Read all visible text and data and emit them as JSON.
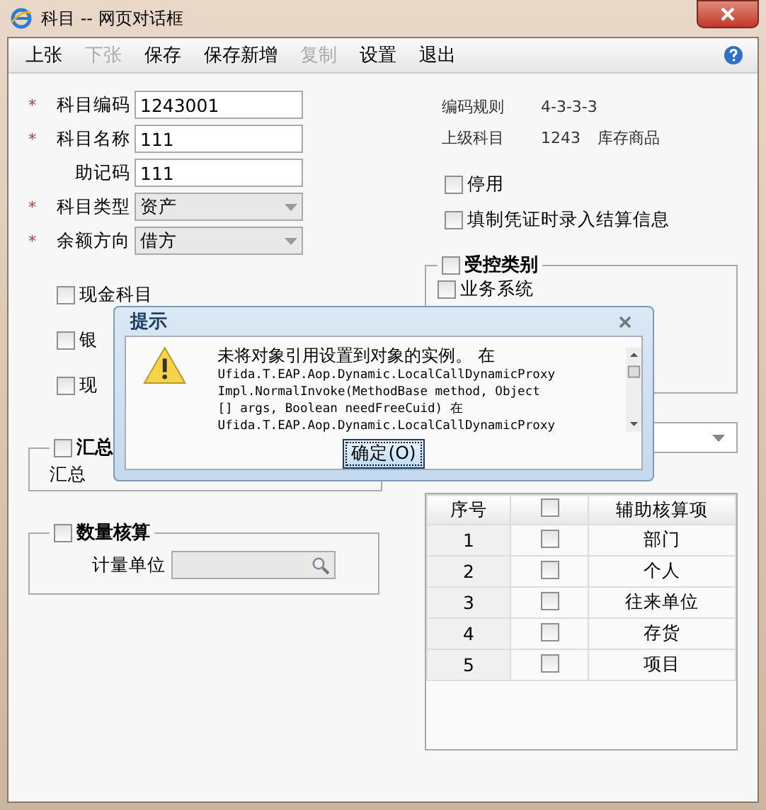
{
  "window": {
    "title": "科目 -- 网页对话框"
  },
  "toolbar": [
    {
      "label": "上张",
      "disabled": false
    },
    {
      "label": "下张",
      "disabled": true
    },
    {
      "label": "保存",
      "disabled": false
    },
    {
      "label": "保存新增",
      "disabled": false
    },
    {
      "label": "复制",
      "disabled": true
    },
    {
      "label": "设置",
      "disabled": false
    },
    {
      "label": "退出",
      "disabled": false
    }
  ],
  "required_symbol": "*",
  "fields": [
    {
      "label": "科目编码",
      "required": true,
      "kind": "text",
      "value": "1243001"
    },
    {
      "label": "科目名称",
      "required": true,
      "kind": "text",
      "value": "111"
    },
    {
      "label": "助记码",
      "required": false,
      "kind": "text",
      "value": "111"
    },
    {
      "label": "科目类型",
      "required": true,
      "kind": "select",
      "value": "资产"
    },
    {
      "label": "余额方向",
      "required": true,
      "kind": "select",
      "value": "借方"
    }
  ],
  "info": [
    {
      "label": "编码规则",
      "values": [
        "4-3-3-3"
      ]
    },
    {
      "label": "上级科目",
      "values": [
        "1243",
        "库存商品"
      ]
    }
  ],
  "options": [
    {
      "label": "停用",
      "checked": false
    },
    {
      "label": "填制凭证时录入结算信息",
      "checked": false
    }
  ],
  "cash_options": [
    {
      "label": "现金科目",
      "checked": false
    },
    {
      "label": "银",
      "checked": false
    },
    {
      "label": "现",
      "checked": false
    }
  ],
  "summary_group": {
    "title": "汇总",
    "checked": false,
    "text": "汇总"
  },
  "quantity_group": {
    "title": "数量核算",
    "checked": false,
    "unit_label": "计量单位"
  },
  "control_group": {
    "title": "受控类别",
    "checked": false,
    "items": [
      {
        "label": "业务系统",
        "checked": false
      }
    ]
  },
  "aux_table": {
    "columns": [
      "序号",
      "辅助核算项"
    ],
    "header_checked": false,
    "rows": [
      {
        "index": "1",
        "name": "部门",
        "checked": false
      },
      {
        "index": "2",
        "name": "个人",
        "checked": false
      },
      {
        "index": "3",
        "name": "往来单位",
        "checked": false
      },
      {
        "index": "4",
        "name": "存货",
        "checked": false
      },
      {
        "index": "5",
        "name": "项目",
        "checked": false
      }
    ]
  },
  "dialog": {
    "title": "提示",
    "message": "未将对象引用设置到对象的实例。 在",
    "details": [
      "Ufida.T.EAP.Aop.Dynamic.LocalCallDynamicProxy",
      "Impl.NormalInvoke(MethodBase method, Object",
      "[] args, Boolean needFreeCuid) 在",
      "Ufida.T.EAP.Aop.Dynamic.LocalCallDynamicProxy"
    ],
    "button": "确定(O)"
  }
}
